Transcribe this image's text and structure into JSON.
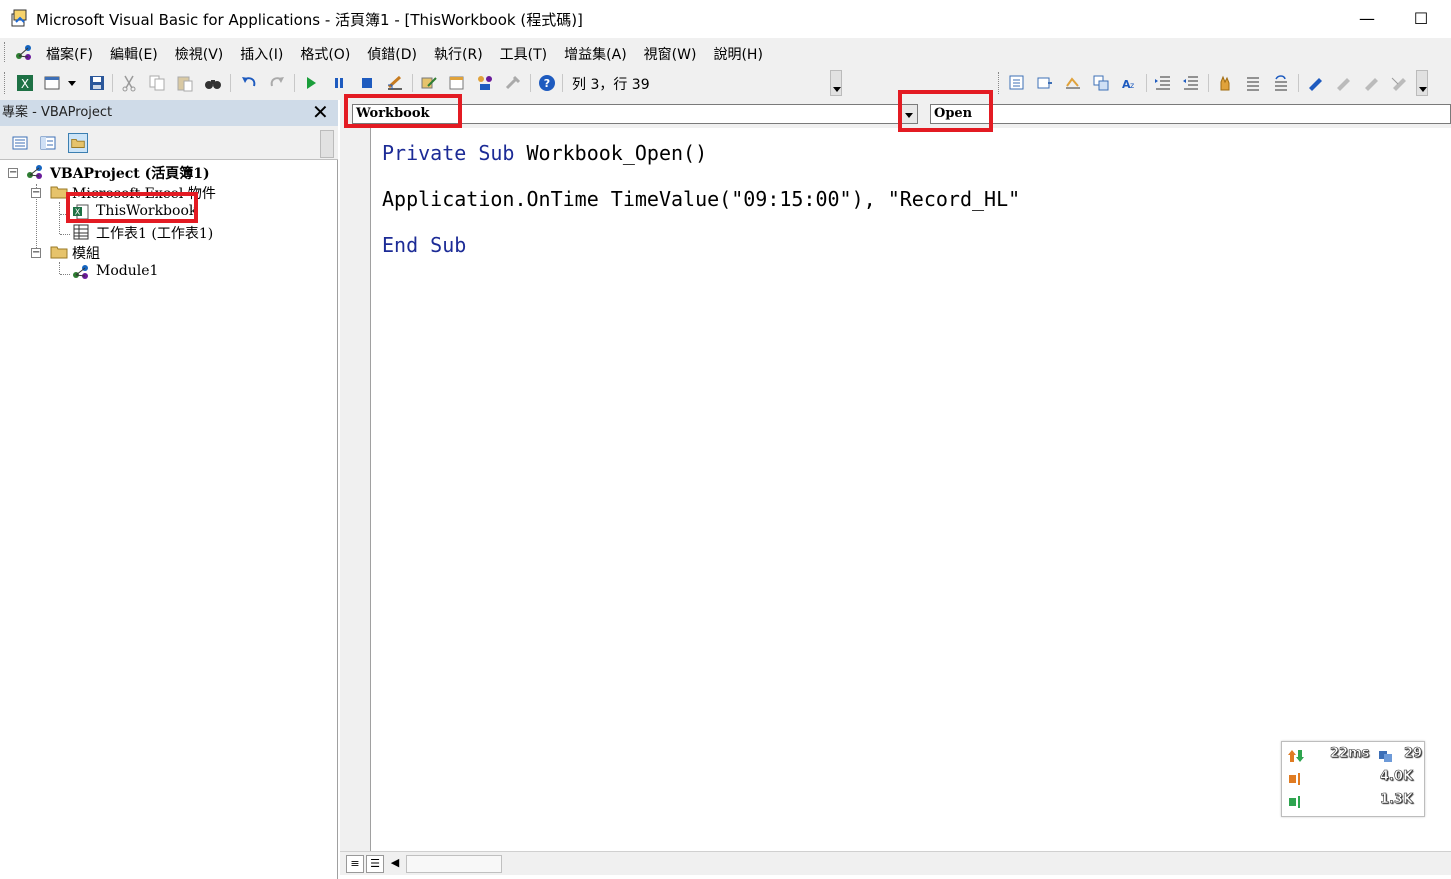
{
  "window": {
    "title": "Microsoft Visual Basic for Applications - 活頁簿1 - [ThisWorkbook (程式碼)]",
    "minimize_label": "—",
    "maximize_label": "☐"
  },
  "menubar": {
    "items": [
      "檔案(F)",
      "編輯(E)",
      "檢視(V)",
      "插入(I)",
      "格式(O)",
      "偵錯(D)",
      "執行(R)",
      "工具(T)",
      "增益集(A)",
      "視窗(W)",
      "說明(H)"
    ]
  },
  "toolbar": {
    "position_text": "列 3，行 39"
  },
  "project": {
    "title": "專案 - VBAProject",
    "close_label": "✕",
    "root": "VBAProject (活頁簿1)",
    "excel_objects": "Microsoft Excel 物件",
    "thisworkbook": "ThisWorkbook",
    "sheet1": "工作表1 (工作表1)",
    "modules": "模組",
    "module1": "Module1",
    "expand_minus": "−"
  },
  "code": {
    "object_combo": "Workbook",
    "proc_combo": "Open",
    "line1_kw1": "Private",
    "line1_kw2": "Sub",
    "line1_rest": " Workbook_Open()",
    "line2": "Application.OnTime TimeValue(\"09:15:00\"), \"Record_HL\"",
    "line3_kw1": "End",
    "line3_kw2": "Sub"
  },
  "netmeter": {
    "latency": "22ms",
    "count": "29",
    "upload": "4.0K",
    "download": "1.3K"
  },
  "colors": {
    "keyword": "#1c2b96",
    "highlight_box": "#e31b23",
    "pane_header": "#cfdbe8"
  }
}
